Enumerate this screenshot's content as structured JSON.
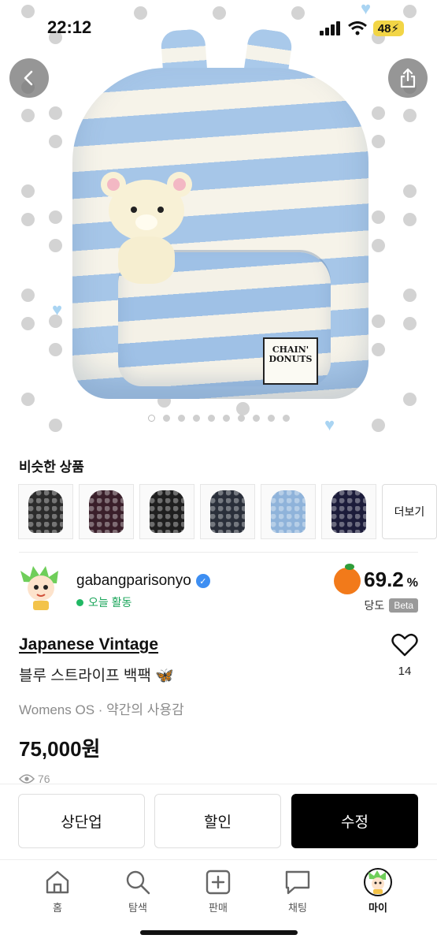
{
  "status_bar": {
    "time": "22:12",
    "battery": "48"
  },
  "hero": {
    "tag_line1": "CHAIN'",
    "tag_line2": "DONUTS",
    "image_count": 10,
    "active_index": 0
  },
  "top_buttons": {
    "back_icon": "chevron-left-icon",
    "share_icon": "share-icon"
  },
  "similar": {
    "title": "비슷한 상품",
    "more_label": "더보기",
    "thumb_colors": [
      "#2b2b2b",
      "#3a1f2a",
      "#1f1f1f",
      "#2a2f3a",
      "#8fb3da",
      "#1c1c3a"
    ]
  },
  "seller": {
    "name": "gabangparisonyo",
    "status": "오늘 활동",
    "temperature": "69.2",
    "temperature_unit": "%",
    "manner_label": "당도",
    "beta_label": "Beta"
  },
  "product": {
    "brand": "Japanese Vintage",
    "title": "블루 스트라이프 백팩 🦋",
    "meta": "Womens OS · 약간의 사용감",
    "price": "75,000원",
    "views": "76",
    "likes": "14"
  },
  "actions": {
    "bump": "상단업",
    "discount": "할인",
    "edit": "수정"
  },
  "nav": {
    "home": "홈",
    "search": "탐색",
    "sell": "판매",
    "chat": "채팅",
    "my": "마이"
  },
  "colors": {
    "accent_green": "#20b864",
    "verified_blue": "#3d8ef2",
    "orange": "#f27a1a"
  }
}
